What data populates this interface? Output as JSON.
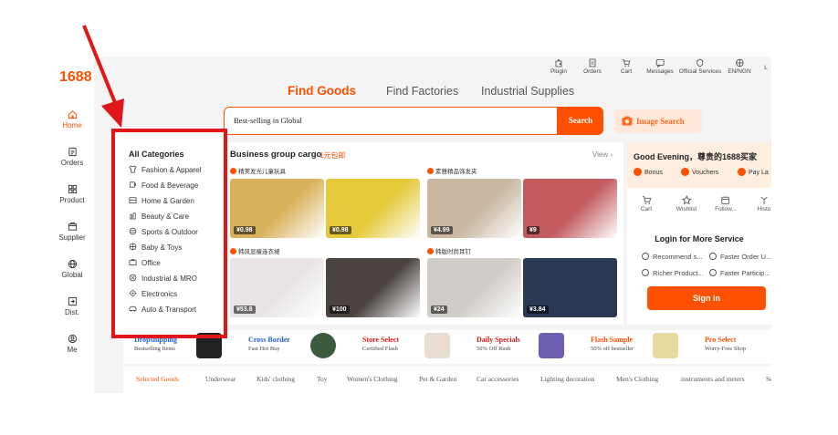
{
  "brand": {
    "logo": "1688",
    "accent": "#ff5000",
    "annotation_color": "#e0161b"
  },
  "sidebar": {
    "items": [
      {
        "label": "Home",
        "icon": "home-icon",
        "active": true
      },
      {
        "label": "Orders",
        "icon": "orders-icon"
      },
      {
        "label": "Product",
        "icon": "product-icon"
      },
      {
        "label": "Supplier",
        "icon": "supplier-icon"
      },
      {
        "label": "Global",
        "icon": "globe-icon"
      },
      {
        "label": "Dist.",
        "icon": "distribution-icon"
      },
      {
        "label": "Me",
        "icon": "user-icon"
      }
    ]
  },
  "top_icons": [
    {
      "label": "Plugin",
      "icon": "plugin-icon"
    },
    {
      "label": "Orders",
      "icon": "orders-icon"
    },
    {
      "label": "Cart",
      "icon": "cart-icon"
    },
    {
      "label": "Messages",
      "icon": "messages-icon"
    },
    {
      "label": "Official Services",
      "icon": "services-icon"
    },
    {
      "label": "EN/NGN",
      "icon": "language-icon"
    },
    {
      "label": "L",
      "icon": "more-icon"
    }
  ],
  "nav_tabs": [
    {
      "label": "Find Goods",
      "active": true
    },
    {
      "label": "Find Factories"
    },
    {
      "label": "Industrial Supplies"
    }
  ],
  "search": {
    "value": "Best-selling in Global",
    "button": "Search",
    "image_search": "Image Search"
  },
  "categories": {
    "title": "All Categories",
    "items": [
      {
        "label": "Fashion & Apparel",
        "icon": "shirt-icon"
      },
      {
        "label": "Food & Beverage",
        "icon": "cup-icon"
      },
      {
        "label": "Home & Garden",
        "icon": "home-garden-icon"
      },
      {
        "label": "Beauty & Care",
        "icon": "beauty-icon"
      },
      {
        "label": "Sports & Outdoor",
        "icon": "sports-icon"
      },
      {
        "label": "Baby & Toys",
        "icon": "baby-icon"
      },
      {
        "label": "Office",
        "icon": "office-icon"
      },
      {
        "label": "Industrial & MRO",
        "icon": "industrial-icon"
      },
      {
        "label": "Electronics",
        "icon": "electronics-icon"
      },
      {
        "label": "Auto & Transport",
        "icon": "car-icon"
      }
    ]
  },
  "business_cargo": {
    "title": "Business group cargo",
    "tag": "1元包邮",
    "view": "View ›",
    "shops": [
      "精美发光儿童玩具",
      "素雅精品饰发夹",
      "韩风显瘦连衣裙",
      "韩版时尚耳钉"
    ],
    "products": [
      {
        "price": "¥0.98",
        "color": "#d9b15a"
      },
      {
        "price": "¥0.98",
        "color": "#e5c93a"
      },
      {
        "price": "¥4.99",
        "color": "#c9b6a0"
      },
      {
        "price": "¥9",
        "color": "#c25a5e"
      },
      {
        "price": "¥53.8",
        "color": "#e8e4e6"
      },
      {
        "price": "¥100",
        "color": "#4a4340"
      },
      {
        "price": "¥24",
        "color": "#cfcbc6"
      },
      {
        "price": "¥3.84",
        "color": "#2a3a55"
      }
    ]
  },
  "account": {
    "greeting": "Good Evening，尊贵的1688买家",
    "perks": [
      "Bonus",
      "Vouchers",
      "Pay La"
    ],
    "quick": [
      {
        "label": "Cart",
        "icon": "cart-icon"
      },
      {
        "label": "Wishlist",
        "icon": "star-icon"
      },
      {
        "label": "Follow...",
        "icon": "follow-icon"
      },
      {
        "label": "Histo",
        "icon": "history-icon"
      }
    ],
    "login_title": "Login for More Service",
    "features": [
      "Recommend s...",
      "Faster Order U...",
      "Richer Product...",
      "Faster Particip..."
    ],
    "signin": "Sign in"
  },
  "promos": [
    {
      "title": "Dropshipping",
      "sub": "Bestselling Items",
      "color": "#1f5fd1"
    },
    {
      "title": "Cross Border",
      "sub": "Fast Hot Buy",
      "color": "#1f5fd1"
    },
    {
      "title": "Store Select",
      "sub": "Certified Flash",
      "color": "#e0161b"
    },
    {
      "title": "Daily Specials",
      "sub": "50% Off Rush",
      "color": "#e0161b"
    },
    {
      "title": "Flash Sample",
      "sub": "50% off bestseller",
      "color": "#ff5000"
    },
    {
      "title": "Pro Select",
      "sub": "Worry-Free Shop",
      "color": "#ff5000"
    }
  ],
  "category_tabs": [
    "Selected Goods",
    "Underwear",
    "Kids' clothing",
    "Toy",
    "Women's Clothing",
    "Pet & Garden",
    "Car accessories",
    "Lighting decoration",
    "Men's Clothing",
    "instruments and meters",
    "Se"
  ]
}
